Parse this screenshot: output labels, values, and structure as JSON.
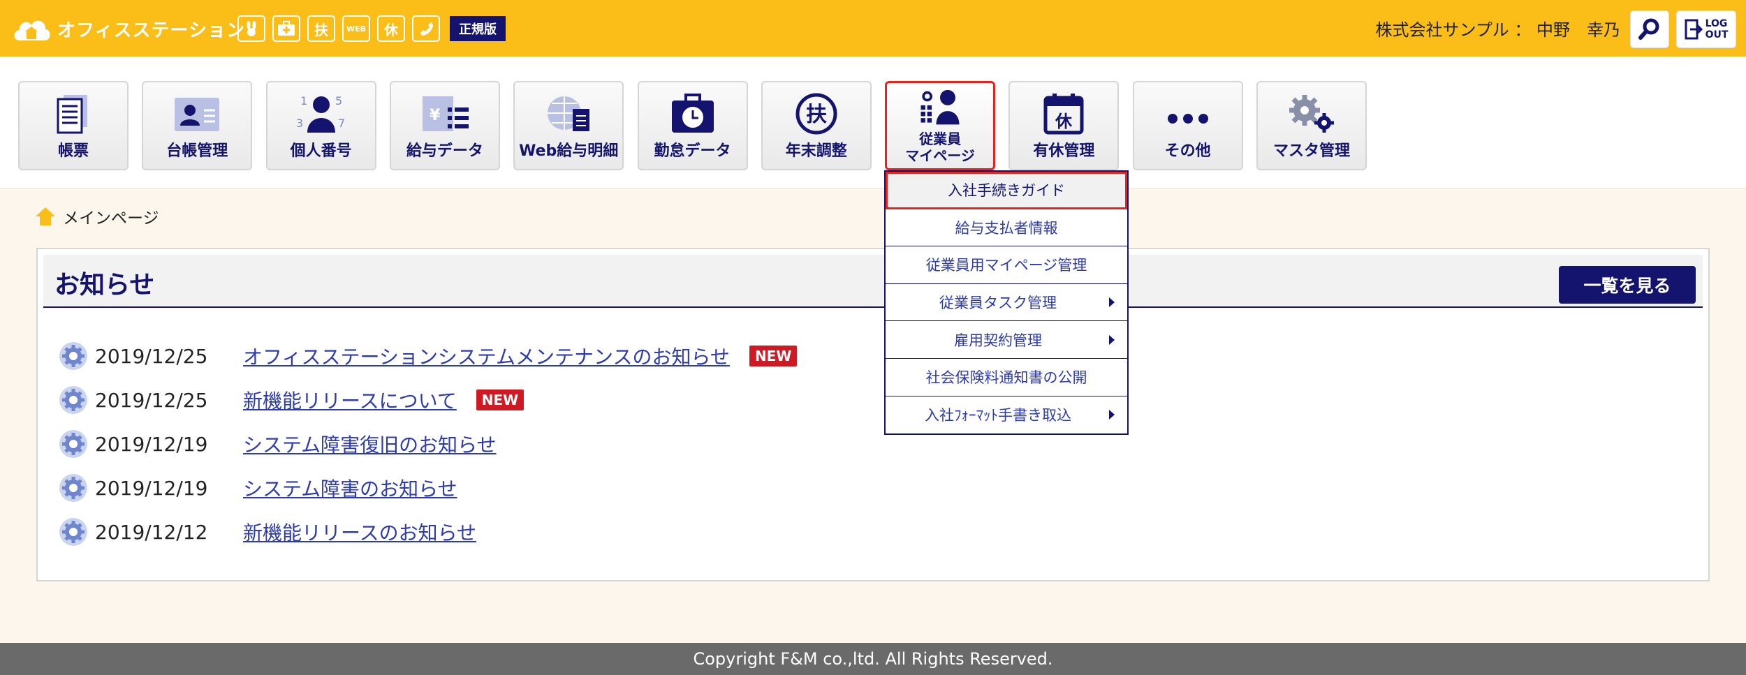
{
  "header": {
    "brand": "オフィスステーション",
    "edition": "正規版",
    "company_user": "株式会社サンプル ： 中野　幸乃",
    "mini_icons": [
      {
        "icon": "rabbit-icon",
        "text": ""
      },
      {
        "icon": "first-aid-icon",
        "text": ""
      },
      {
        "icon": "fu-icon",
        "text": "扶"
      },
      {
        "icon": "web-icon",
        "text": "WEB"
      },
      {
        "icon": "kyu-icon",
        "text": "休"
      },
      {
        "icon": "phone-icon",
        "text": ""
      }
    ],
    "logout_line1": "LOG",
    "logout_line2": "OUT"
  },
  "nav": [
    {
      "name": "nav-item-forms",
      "icon": "document-icon",
      "label": "帳票"
    },
    {
      "name": "nav-item-ledger",
      "icon": "id-card-icon",
      "label": "台帳管理"
    },
    {
      "name": "nav-item-my-number",
      "icon": "person-number-icon",
      "label": "個人番号"
    },
    {
      "name": "nav-item-payroll-data",
      "icon": "yen-list-icon",
      "label": "給与データ"
    },
    {
      "name": "nav-item-web-payslip",
      "icon": "globe-document-icon",
      "label": "Web給与明細"
    },
    {
      "name": "nav-item-attendance",
      "icon": "clock-bag-icon",
      "label": "勤怠データ"
    },
    {
      "name": "nav-item-year-end",
      "icon": "fu-circle-icon",
      "label": "年末調整"
    },
    {
      "name": "nav-item-employee-mypage",
      "icon": "employee-gear-icon",
      "label": "従業員",
      "label2": "マイページ",
      "active": true
    },
    {
      "name": "nav-item-paid-leave",
      "icon": "calendar-kyu-icon",
      "label": "有休管理"
    },
    {
      "name": "nav-item-other",
      "icon": "dots-icon",
      "label": "その他"
    },
    {
      "name": "nav-item-master",
      "icon": "gears-icon",
      "label": "マスタ管理"
    }
  ],
  "breadcrumb": {
    "label": "メインページ"
  },
  "notices": {
    "title": "お知らせ",
    "see_all": "一覧を見る",
    "new_label": "NEW",
    "items": [
      {
        "date": "2019/12/25",
        "text": "オフィスステーションシステムメンテナンスのお知らせ",
        "is_new": true
      },
      {
        "date": "2019/12/25",
        "text": "新機能リリースについて",
        "is_new": true
      },
      {
        "date": "2019/12/19",
        "text": "システム障害復旧のお知らせ",
        "is_new": false
      },
      {
        "date": "2019/12/19",
        "text": "システム障害のお知らせ",
        "is_new": false
      },
      {
        "date": "2019/12/12",
        "text": "新機能リリースのお知らせ",
        "is_new": false
      }
    ]
  },
  "dropdown": {
    "items": [
      {
        "label": "入社手続きガイド",
        "submenu": false,
        "highlighted": true
      },
      {
        "label": "給与支払者情報",
        "submenu": false
      },
      {
        "label": "従業員用マイページ管理",
        "submenu": false
      },
      {
        "label": "従業員タスク管理",
        "submenu": true
      },
      {
        "label": "雇用契約管理",
        "submenu": true
      },
      {
        "label": "社会保険料通知書の公開",
        "submenu": false
      },
      {
        "label": "入社ﾌｫｰﾏｯﾄ手書き取込",
        "submenu": true
      }
    ]
  },
  "footer": {
    "copyright": "Copyright F&M co.,ltd. All Rights Reserved."
  },
  "colors": {
    "header_bg": "#fbbd18",
    "navy": "#14146e",
    "link": "#2c3bb0",
    "new_badge": "#cf1a24",
    "highlight": "#e8231e"
  }
}
